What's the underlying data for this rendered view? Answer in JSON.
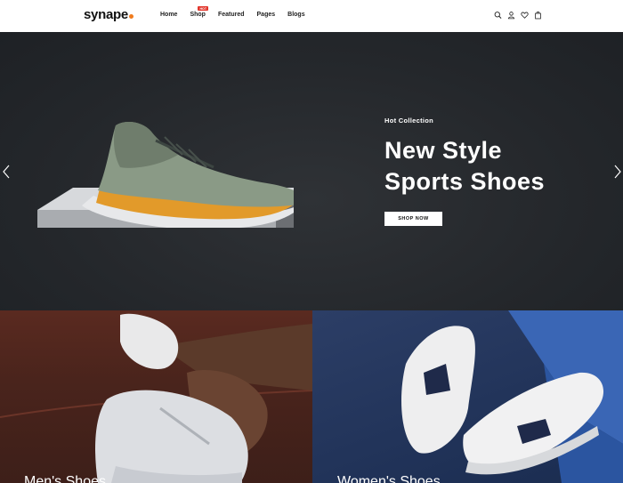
{
  "brand": {
    "name": "synape",
    "dot_color": "#f07b1d"
  },
  "nav": {
    "items": [
      {
        "label": "Home"
      },
      {
        "label": "Shop",
        "badge": "HOT"
      },
      {
        "label": "Featured"
      },
      {
        "label": "Pages"
      },
      {
        "label": "Blogs"
      }
    ]
  },
  "header_icons": [
    "search-icon",
    "user-icon",
    "heart-icon",
    "bag-icon"
  ],
  "hero": {
    "eyebrow": "Hot Collection",
    "title_line1": "New Style",
    "title_line2": "Sports Shoes",
    "button": "SHOP NOW"
  },
  "categories": [
    {
      "label": "Men's Shoes"
    },
    {
      "label": "Women's Shoes"
    }
  ],
  "colors": {
    "hero_bg": "#24272b",
    "badge": "#e2352b",
    "accent": "#f07b1d"
  }
}
